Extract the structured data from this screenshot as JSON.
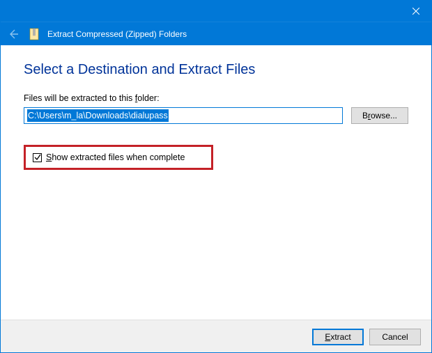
{
  "titlebar": {
    "close_tooltip": "Close"
  },
  "navbar": {
    "title": "Extract Compressed (Zipped) Folders"
  },
  "main": {
    "heading": "Select a Destination and Extract Files",
    "field_label_pre": "Files will be extracted to this ",
    "field_label_ul": "f",
    "field_label_post": "older:",
    "path_value": "C:\\Users\\m_la\\Downloads\\dialupass",
    "browse_ul": "r",
    "browse_label": "Browse...",
    "checkbox_checked": true,
    "checkbox_ul": "S",
    "checkbox_label": "how extracted files when complete"
  },
  "footer": {
    "extract_ul": "E",
    "extract_label": "xtract",
    "cancel_label": "Cancel"
  }
}
